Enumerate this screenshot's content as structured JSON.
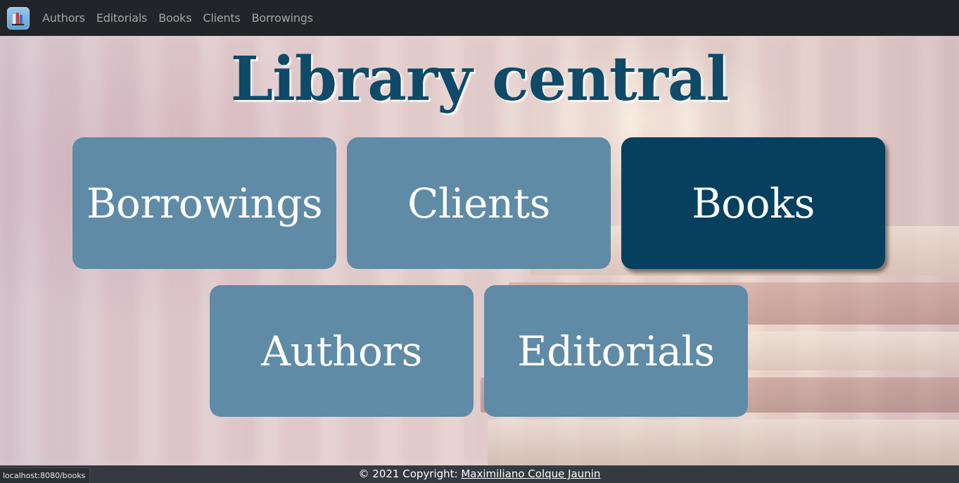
{
  "nav": {
    "items": [
      {
        "label": "Authors"
      },
      {
        "label": "Editorials"
      },
      {
        "label": "Books"
      },
      {
        "label": "Clients"
      },
      {
        "label": "Borrowings"
      }
    ]
  },
  "hero": {
    "title": "Library central"
  },
  "tiles": [
    {
      "label": "Borrowings"
    },
    {
      "label": "Clients"
    },
    {
      "label": "Books",
      "active": true
    },
    {
      "label": "Authors"
    },
    {
      "label": "Editorials"
    }
  ],
  "footer": {
    "copyright": "© 2021 Copyright: ",
    "author_link": "Maximiliano Colque Jaunin"
  },
  "status_bar": {
    "url": "localhost:8080/books"
  },
  "colors": {
    "navbar": "#212529",
    "tile": "#5f8ba6",
    "tile_active": "#06405e",
    "title": "#0f4a68",
    "footer": "#343a40"
  }
}
